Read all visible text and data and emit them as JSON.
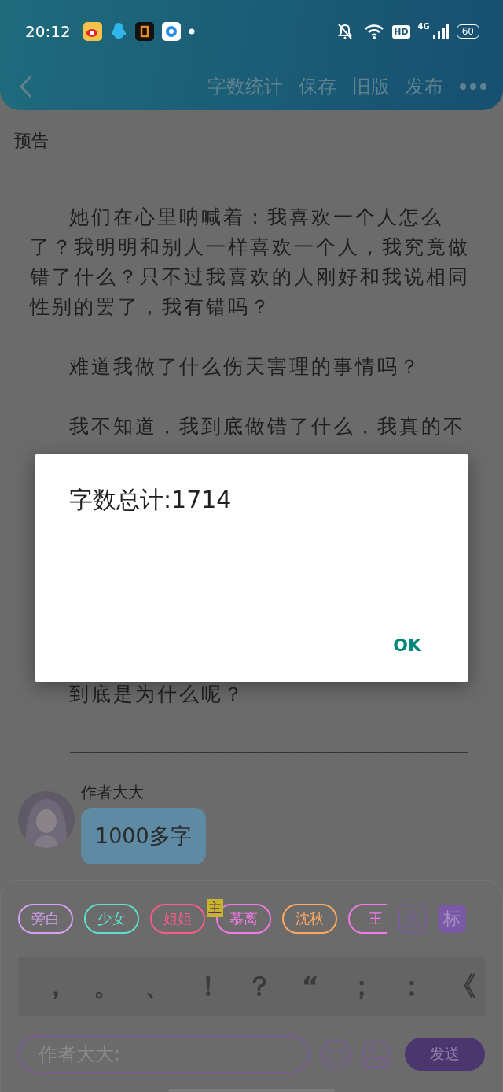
{
  "status_bar": {
    "time": "20:12",
    "hd": "HD",
    "network": "4G",
    "battery": "60"
  },
  "toolbar": {
    "actions": [
      {
        "label": "字数统计"
      },
      {
        "label": "保存"
      },
      {
        "label": "旧版"
      },
      {
        "label": "发布"
      }
    ]
  },
  "chapter": {
    "title": "预告"
  },
  "paragraphs": [
    {
      "text": "她们在心里呐喊着：我喜欢一个人怎么了？我明明和别人一样喜欢一个人，我究竟做错了什么？只不过我喜欢的人刚好和我说相同性别的罢了，我有错吗？"
    },
    {
      "text": "难道我做了什么伤天害理的事情吗？"
    },
    {
      "text": "我不知道，我到底做错了什么，我真的不"
    },
    {
      "text": "到底是为什么呢？"
    },
    {
      "text": "————————————————————————",
      "kind": "rule"
    }
  ],
  "message": {
    "author": "作者大大",
    "text": "1000多字"
  },
  "roles": [
    {
      "label": "旁白",
      "color": "#d8a0f4"
    },
    {
      "label": "少女",
      "color": "#5ee0cc"
    },
    {
      "label": "姐姐",
      "color": "#ff5a8a"
    },
    {
      "label": "慕离",
      "color": "#f47ae8",
      "badge": "主"
    },
    {
      "label": "沈秋",
      "color": "#ffa860"
    },
    {
      "label": "王",
      "color": "#f47ae8"
    }
  ],
  "tag_button": "标",
  "punctuation": [
    "，",
    "。",
    "、",
    "！",
    "？",
    "“",
    "；",
    "：",
    "《"
  ],
  "composer": {
    "placeholder": "作者大大:",
    "send": "发送"
  },
  "dialog": {
    "message": "字数总计:1714",
    "button": "OK"
  }
}
